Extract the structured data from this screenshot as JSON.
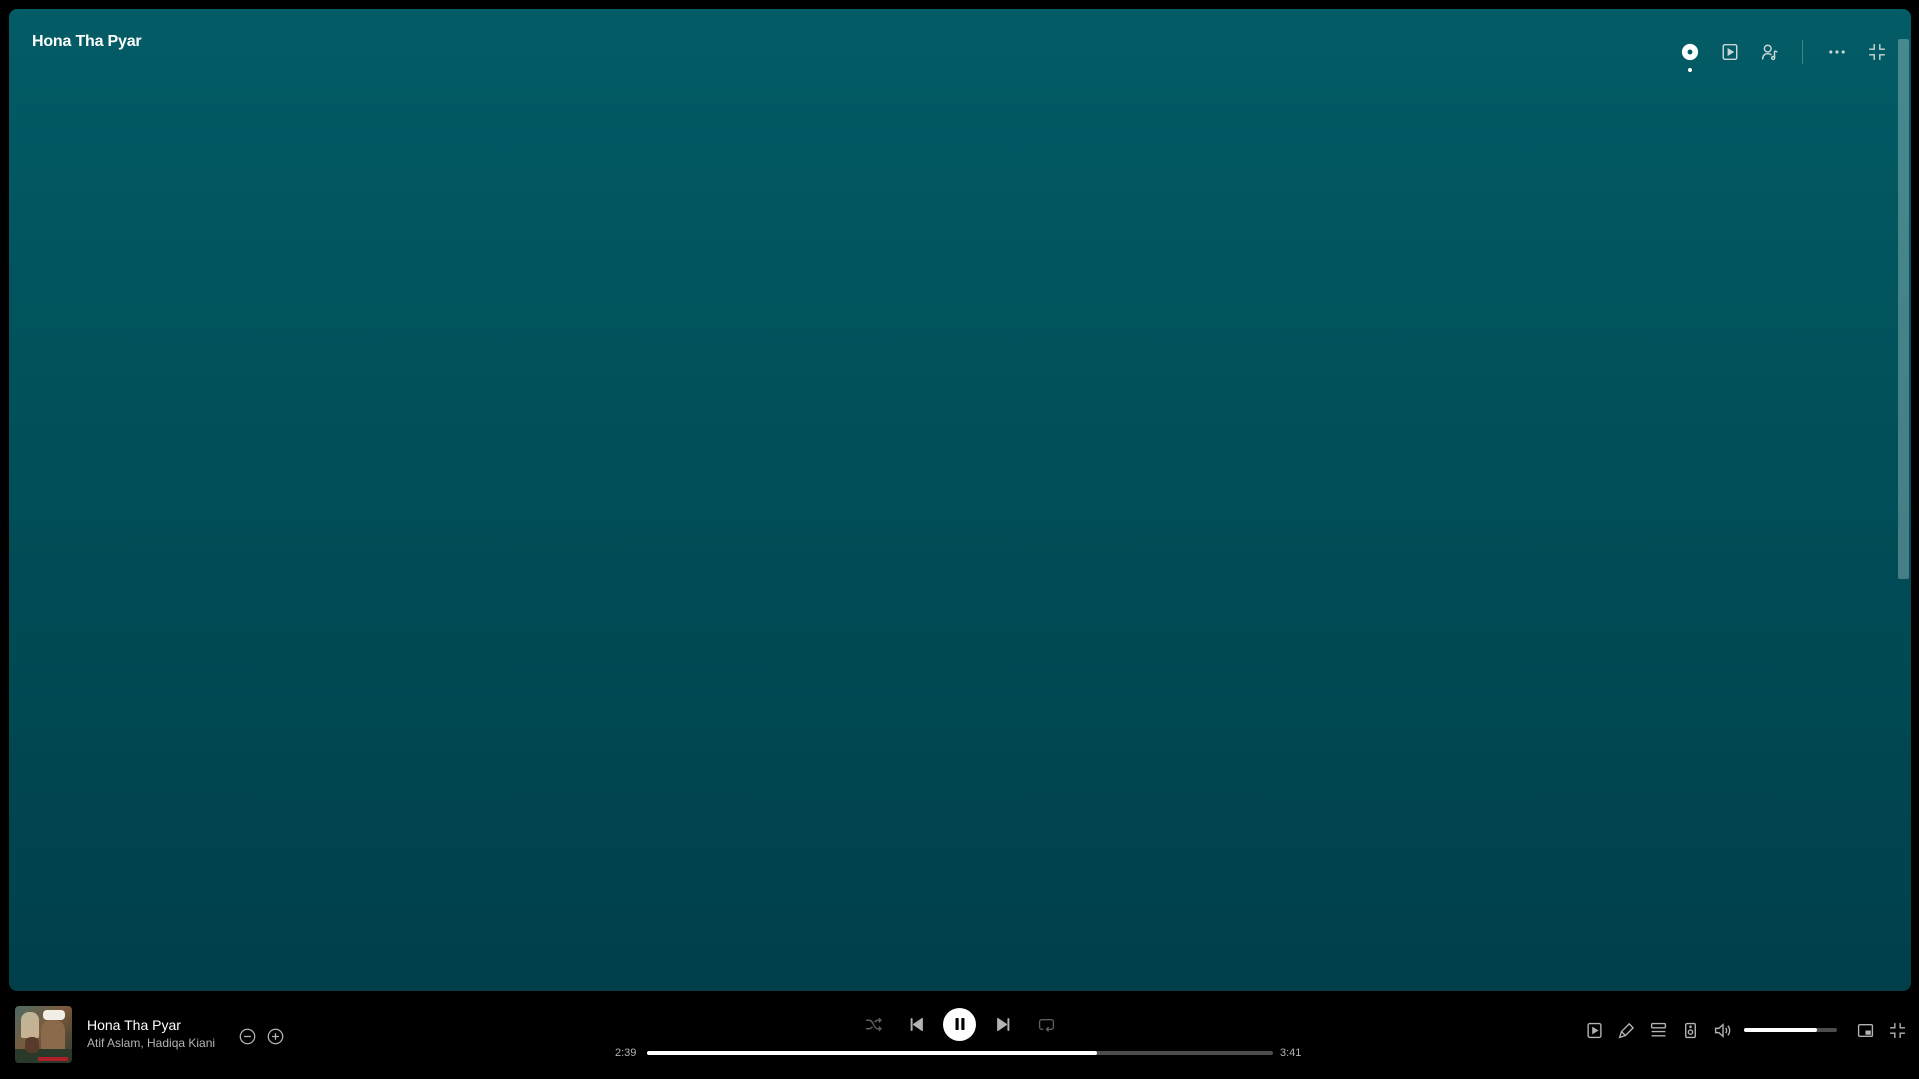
{
  "panel": {
    "title": "Hona Tha Pyar",
    "top_actions": [
      {
        "name": "now-playing-view-icon",
        "active": true
      },
      {
        "name": "video-icon",
        "active": false
      },
      {
        "name": "lyrics-mic-icon",
        "active": false
      },
      {
        "name": "more-options-icon",
        "active": false
      },
      {
        "name": "exit-fullscreen-icon",
        "active": false
      }
    ]
  },
  "player": {
    "track_title": "Hona Tha Pyar",
    "track_artists": "Atif Aslam, Hadiqa Kiani",
    "current_time": "2:39",
    "total_time": "3:41",
    "progress_fraction": 0.719,
    "volume_fraction": 0.78,
    "playing": true
  },
  "colors": {
    "panel_top": "#025c66",
    "panel_bottom": "#003f4a",
    "player_bg": "#000000",
    "progress_fill": "#ffffff",
    "progress_track": "#4d4d4d"
  }
}
